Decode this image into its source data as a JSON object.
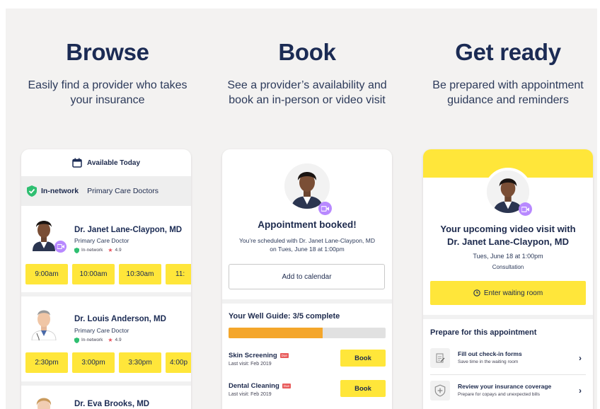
{
  "columns": [
    {
      "heading": "Browse",
      "subtitle": "Easily find a provider who takes your insurance"
    },
    {
      "heading": "Book",
      "subtitle": "See a provider’s availability and book an in-person or video visit"
    },
    {
      "heading": "Get ready",
      "subtitle": "Be prepared with appointment guidance and reminders"
    }
  ],
  "browse": {
    "available_label": "Available Today",
    "network_label": "In-network",
    "specialty_filter": "Primary Care Doctors",
    "providers": [
      {
        "name": "Dr. Janet Lane-Claypon, MD",
        "specialty": "Primary Care Doctor",
        "network": "In-network",
        "rating": "4.9",
        "slots": [
          "9:00am",
          "10:00am",
          "10:30am",
          "11:"
        ]
      },
      {
        "name": "Dr. Louis Anderson, MD",
        "specialty": "Primary Care Doctor",
        "network": "In-network",
        "rating": "4.9",
        "slots": [
          "2:30pm",
          "3:00pm",
          "3:30pm",
          "4:00p"
        ]
      },
      {
        "name": "Dr. Eva Brooks, MD"
      }
    ]
  },
  "book": {
    "title": "Appointment booked!",
    "confirmation_line1": "You’re scheduled with Dr. Janet Lane-Claypon, MD",
    "confirmation_line2": "on Tues, June 18 at 1:00pm",
    "add_calendar": "Add to calendar",
    "well_guide": "Your Well Guide: 3/5 complete",
    "progress": 0.6,
    "tasks": [
      {
        "name": "Skin Screening",
        "badge": "Due",
        "last": "Last visit: Feb 2019",
        "action": "Book"
      },
      {
        "name": "Dental Cleaning",
        "badge": "Due",
        "last": "Last visit: Feb 2019",
        "action": "Book"
      }
    ]
  },
  "ready": {
    "title_line1": "Your upcoming video visit with",
    "title_line2": "Dr. Janet Lane-Claypon, MD",
    "when": "Tues, June 18 at 1:00pm",
    "kind": "Consultation",
    "enter": "Enter waiting room",
    "prepare": "Prepare for this appointment",
    "items": [
      {
        "title": "Fill out check-in forms",
        "desc": "Save time in the waiting room"
      },
      {
        "title": "Review your insurance coverage",
        "desc": "Prepare for copays and unexpected bills"
      }
    ]
  },
  "colors": {
    "yellow": "#ffe63a",
    "navy": "#1b2b54",
    "orange": "#f4a62b",
    "purple": "#b889ff",
    "green": "#2fbf71"
  }
}
